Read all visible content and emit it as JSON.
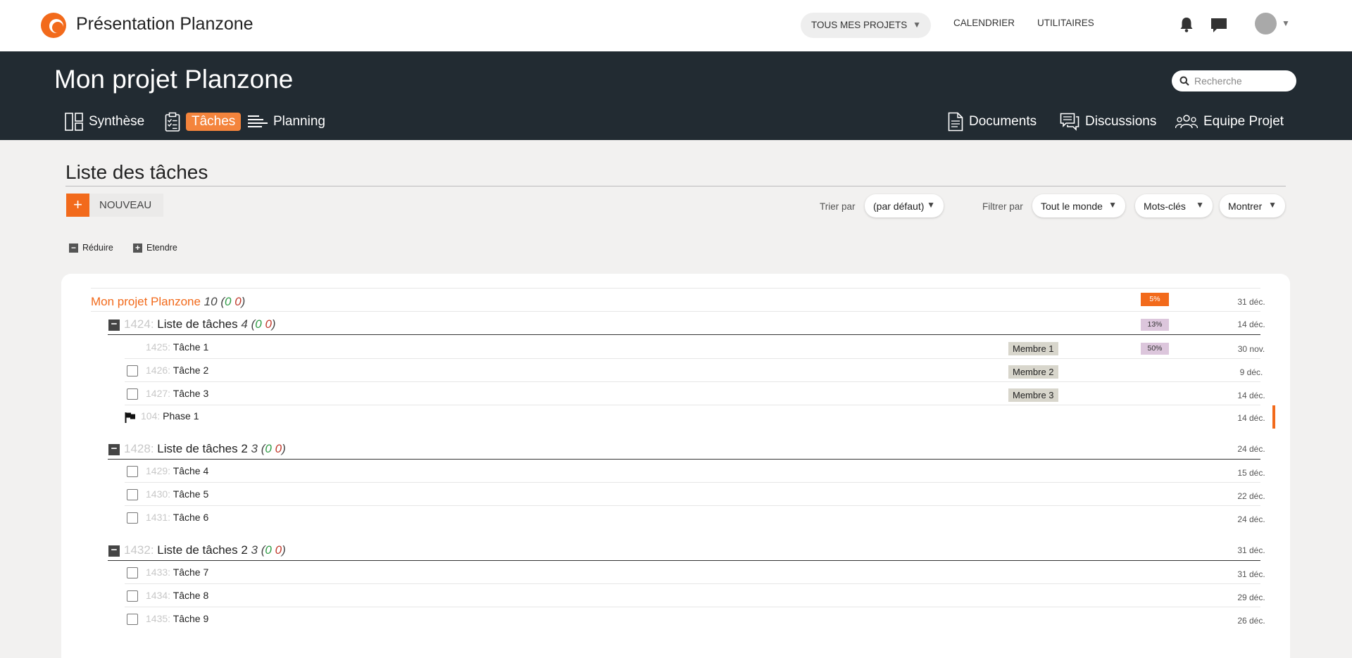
{
  "topbar": {
    "app_title": "Présentation Planzone",
    "projects_select": "TOUS MES PROJETS",
    "nav": [
      "CALENDRIER",
      "UTILITAIRES"
    ]
  },
  "header": {
    "project_title": "Mon projet Planzone",
    "search_placeholder": "Recherche",
    "tabs_left": [
      {
        "label": "Synthèse",
        "icon": "synthesis-icon"
      },
      {
        "label": "Tâches",
        "icon": "tasks-clipboard-icon",
        "active": true
      },
      {
        "label": "Planning",
        "icon": "gantt-icon"
      }
    ],
    "tabs_right": [
      {
        "label": "Documents",
        "icon": "document-icon"
      },
      {
        "label": "Discussions",
        "icon": "discussion-icon"
      },
      {
        "label": "Equipe Projet",
        "icon": "team-icon"
      }
    ]
  },
  "list": {
    "title": "Liste des tâches",
    "new_button": "NOUVEAU",
    "sort_label": "Trier par",
    "sort_value": "(par défaut)",
    "filter_label": "Filtrer par",
    "filter_value": "Tout le monde",
    "keywords_value": "Mots-clés",
    "show_value": "Montrer",
    "collapse_label": "Réduire",
    "expand_label": "Etendre"
  },
  "tree": {
    "project": {
      "name": "Mon projet Planzone",
      "count": "10",
      "green": "0",
      "red": "0",
      "progress": "5%",
      "date": "31 déc."
    },
    "sections": [
      {
        "id": "1424:",
        "name": "Liste de tâches",
        "count": "4",
        "green": "0",
        "red": "0",
        "progress": "13%",
        "date": "14 déc.",
        "items": [
          {
            "id": "1425:",
            "name": "Tâche 1",
            "member": "Membre 1",
            "progress": "50%",
            "date": "30 nov.",
            "checkbox": false
          },
          {
            "id": "1426:",
            "name": "Tâche 2",
            "member": "Membre 2",
            "date": "9 déc.",
            "checkbox": true
          },
          {
            "id": "1427:",
            "name": "Tâche 3",
            "member": "Membre 3",
            "date": "14 déc.",
            "checkbox": true
          },
          {
            "id": "104:",
            "name": "Phase 1",
            "date": "14 déc.",
            "flag": true
          }
        ]
      },
      {
        "id": "1428:",
        "name": "Liste de tâches 2",
        "count": "3",
        "green": "0",
        "red": "0",
        "date": "24 déc.",
        "items": [
          {
            "id": "1429:",
            "name": "Tâche 4",
            "date": "15 déc.",
            "checkbox": true
          },
          {
            "id": "1430:",
            "name": "Tâche 5",
            "date": "22 déc.",
            "checkbox": true
          },
          {
            "id": "1431:",
            "name": "Tâche 6",
            "date": "24 déc.",
            "checkbox": true
          }
        ]
      },
      {
        "id": "1432:",
        "name": "Liste de tâches 2",
        "count": "3",
        "green": "0",
        "red": "0",
        "date": "31 déc.",
        "items": [
          {
            "id": "1433:",
            "name": "Tâche 7",
            "date": "31 déc.",
            "checkbox": true
          },
          {
            "id": "1434:",
            "name": "Tâche 8",
            "date": "29 déc.",
            "checkbox": true
          },
          {
            "id": "1435:",
            "name": "Tâche 9",
            "date": "26 déc.",
            "checkbox": true
          }
        ]
      }
    ]
  },
  "colors": {
    "accent": "#f26a1b",
    "header_bg": "#222b32",
    "pct_bg": "#dcc6dc"
  }
}
